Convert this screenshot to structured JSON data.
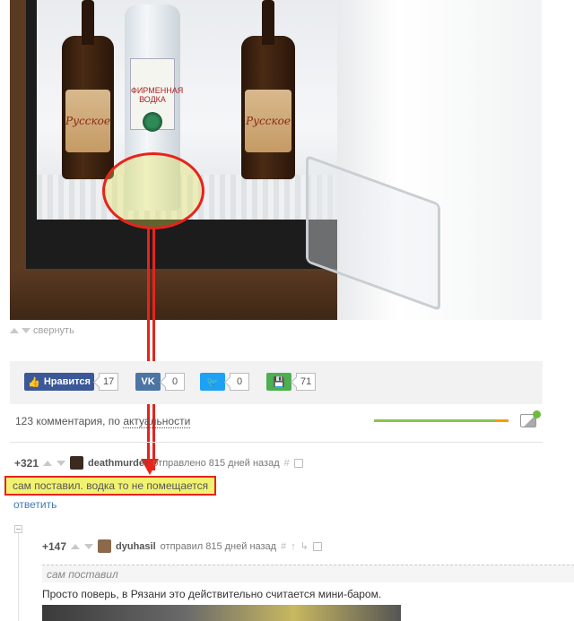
{
  "photo": {
    "beer_label_left": "Русское",
    "beer_label_right": "Русское",
    "vodka_label_line1": "ФИРМЕННАЯ",
    "vodka_label_line2": "ВОДКА"
  },
  "post": {
    "collapse_label": "свернуть"
  },
  "share": {
    "facebook_label": "Нравится",
    "facebook_count": "17",
    "vk_count": "0",
    "twitter_count": "0",
    "save_count": "71"
  },
  "comments": {
    "count_label": "123 комментария, по ",
    "sort_label": "актуальности"
  },
  "comment1": {
    "rating": "+321",
    "username": "deathmurder",
    "meta": "отправлено 815 дней назад",
    "hash": "#",
    "text": "сам поставил. водка то не помещается",
    "reply_label": "ответить"
  },
  "comment2": {
    "rating": "+147",
    "username": "dyuhasil",
    "meta": "отправил 815 дней назад",
    "hash": "#",
    "quote": "сам поставил",
    "text": "Просто поверь, в Рязани это действительно считается мини-баром."
  },
  "colors": {
    "highlight_red": "#e8231c",
    "facebook": "#3b5998",
    "vk": "#4c75a3",
    "twitter": "#1da1f2",
    "save": "#4caf50",
    "link": "#3e7bb6"
  },
  "progress": 0.93
}
